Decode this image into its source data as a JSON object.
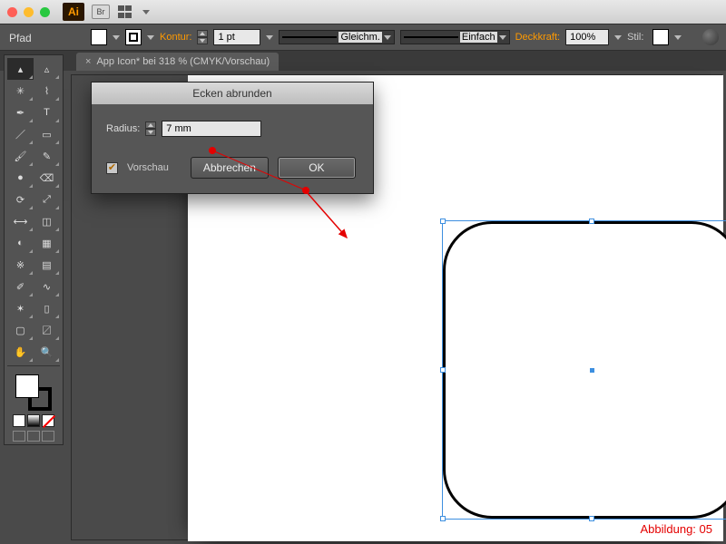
{
  "titlebar": {
    "traffic_colors": [
      "#ff5f57",
      "#febc2e",
      "#28c840"
    ],
    "ai_label": "Ai",
    "br_label": "Br"
  },
  "property_label": "Pfad",
  "ctrl": {
    "kontur_label": "Kontur:",
    "stroke_weight": "1 pt",
    "cap_label": "Gleichm.",
    "profile_label": "Einfach",
    "opacity_label": "Deckkraft:",
    "opacity_value": "100%",
    "style_label": "Stil:"
  },
  "doc_tab": {
    "title": "App Icon* bei 318 % (CMYK/Vorschau)",
    "close": "×"
  },
  "dialog": {
    "title": "Ecken abrunden",
    "radius_label": "Radius:",
    "radius_value": "7 mm",
    "preview_label": "Vorschau",
    "preview_checked": true,
    "cancel": "Abbrechen",
    "ok": "OK"
  },
  "caption": "Abbildung: 05",
  "tool_names": [
    [
      "selection",
      "direct-selection"
    ],
    [
      "magic-wand",
      "lasso"
    ],
    [
      "pen",
      "type"
    ],
    [
      "line-segment",
      "rectangle"
    ],
    [
      "paintbrush",
      "pencil"
    ],
    [
      "blob-brush",
      "eraser"
    ],
    [
      "rotate",
      "scale"
    ],
    [
      "width",
      "free-transform"
    ],
    [
      "shape-builder",
      "perspective-grid"
    ],
    [
      "mesh",
      "gradient"
    ],
    [
      "eyedropper",
      "blend"
    ],
    [
      "symbol-sprayer",
      "column-graph"
    ],
    [
      "artboard",
      "slice"
    ],
    [
      "hand",
      "zoom"
    ]
  ],
  "tool_glyphs": [
    [
      "▴",
      "▵"
    ],
    [
      "✳",
      "⌇"
    ],
    [
      "✒",
      "T"
    ],
    [
      "／",
      "▭"
    ],
    [
      "🖌",
      "✎"
    ],
    [
      "●",
      "⌫"
    ],
    [
      "⟳",
      "⤢"
    ],
    [
      "⟷",
      "◫"
    ],
    [
      "◐",
      "▦"
    ],
    [
      "※",
      "▤"
    ],
    [
      "✐",
      "∿"
    ],
    [
      "✶",
      "▯"
    ],
    [
      "▢",
      "〼"
    ],
    [
      "✋",
      "🔍"
    ]
  ]
}
